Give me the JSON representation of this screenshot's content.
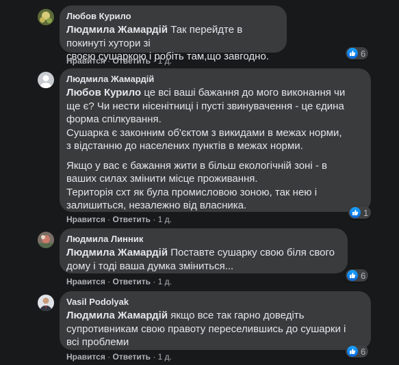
{
  "comments": [
    {
      "author": "Любов Курило",
      "mention": "Людмила Жамардій",
      "lines": [
        "Так перейдте в покинуті хутори зі",
        "своєю сушаркою і робіть там,що завгодно."
      ],
      "like_label": "Нравится",
      "reply_label": "Ответить",
      "time": "1 д.",
      "reactions": "6"
    },
    {
      "author": "Людмила Жамардій",
      "mention": "Любов Курило",
      "lines": [
        "це всі ваші бажання до мого виконання чи",
        "ще є? Чи нести нісенітниці і пусті звинувачення - це єдина",
        "форма спілкування.",
        "Сушарка є законним об'єктом з викидами в межах норми,",
        "з відстанню до населених пунктів в межах норми."
      ],
      "para2": [
        "Якщо у вас є бажання жити в більш екологічній зоні - в",
        "ваших силах змінити місце проживання.",
        "Територія схт як була промисловою зоною, так нею і",
        "залишиться, незалежно від власника."
      ],
      "like_label": "Нравится",
      "reply_label": "Ответить",
      "time": "1 д.",
      "reactions": "1"
    },
    {
      "author": "Людмила Линник",
      "mention": "Людмила Жамардій",
      "lines": [
        "Поставте сушарку свою біля свого",
        "дому і тоді ваша думка зміниться..."
      ],
      "like_label": "Нравится",
      "reply_label": "Ответить",
      "time": "1 д.",
      "reactions": "6"
    },
    {
      "author": "Vasil Podolyak",
      "mention": "Людмила Жамардій",
      "lines": [
        "якщо все так гарно доведіть",
        "супротивникам свою правоту переселившись до сушарки і",
        "всі проблеми"
      ],
      "like_label": "Нравится",
      "reply_label": "Ответить",
      "time": "1 д.",
      "reactions": "6"
    }
  ],
  "separator": "·",
  "colors": {
    "background": "#18191a",
    "bubble": "#3a3b3c",
    "meta": "#b0b3b8",
    "like": "#1877f2"
  },
  "icons": {
    "reaction": "like-icon"
  }
}
